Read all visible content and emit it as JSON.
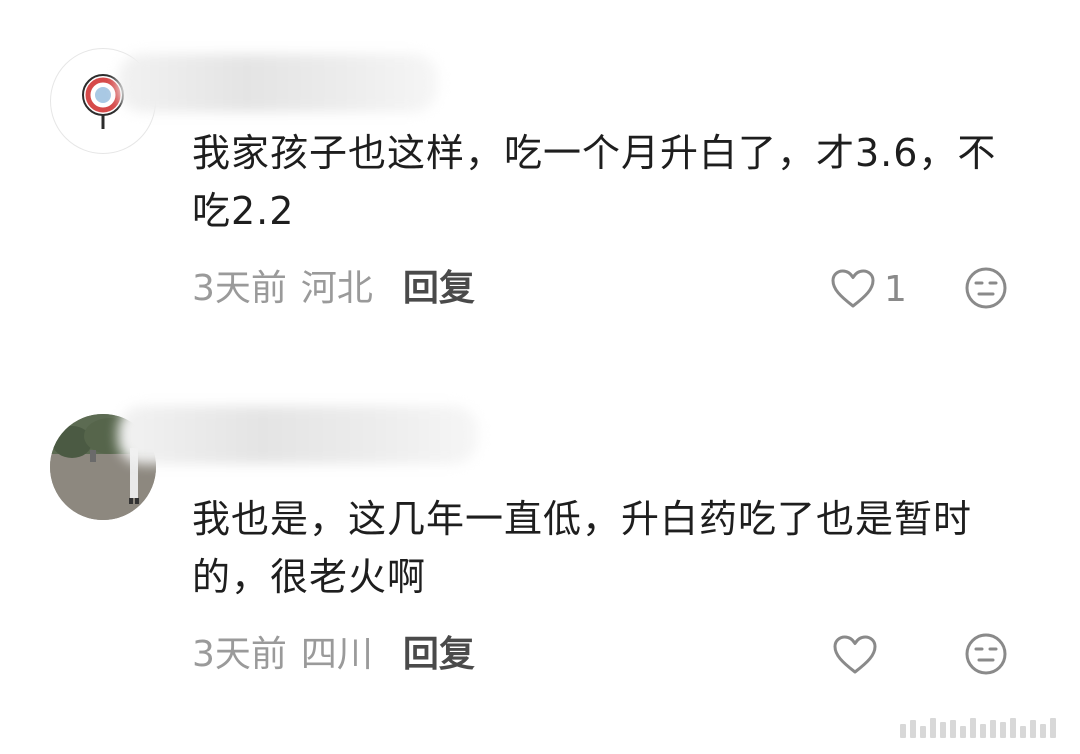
{
  "comments": [
    {
      "text": "我家孩子也这样，吃一个月升白了，才3.6，不吃2.2",
      "time": "3天前",
      "region": "河北",
      "reply": "回复",
      "like_count": "1",
      "avatar_icon": "target-logo-icon"
    },
    {
      "text": "我也是，这几年一直低，升白药吃了也是暂时的，很老火啊",
      "time": "3天前",
      "region": "四川",
      "reply": "回复",
      "like_count": "",
      "avatar_icon": "park-photo-avatar"
    }
  ],
  "icons": {
    "like": "heart-outline-icon",
    "emoji": "neutral-face-icon"
  },
  "colors": {
    "text": "#1e1e1e",
    "meta": "#9a9a9a",
    "reply": "#4a4a4a",
    "icon": "#8a8a8a"
  }
}
